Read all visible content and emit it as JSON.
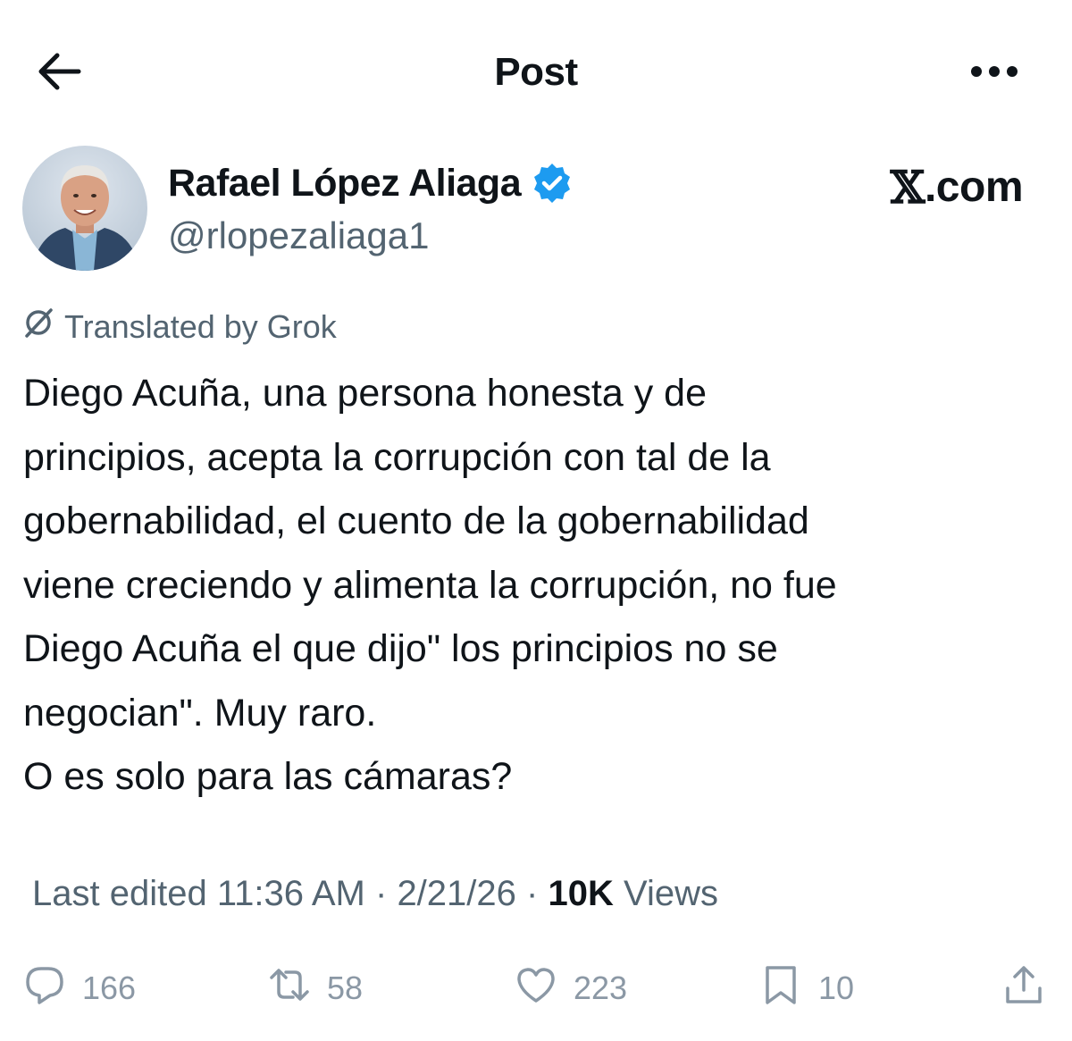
{
  "header": {
    "title": "Post",
    "back_icon": "arrow-left-icon",
    "more_icon": "more-horizontal-icon"
  },
  "author": {
    "name": "Rafael López Aliaga",
    "handle": "@rlopezaliaga1",
    "verified_icon": "verified-badge-icon",
    "verified_color": "#1d9bf0"
  },
  "brand": {
    "logo": "𝕏",
    "domain": ".com"
  },
  "translation": {
    "label": "Translated by Grok",
    "icon": "grok-icon"
  },
  "tweet": {
    "lines": [
      "Diego Acuña, una persona honesta y de",
      "principios, acepta la corrupción con tal de la",
      "gobernabilidad, el cuento de la gobernabilidad",
      "viene creciendo y alimenta la corrupción, no fue",
      "Diego Acuña el que dijo\" los principios no se",
      "negocian\". Muy raro.",
      "O es solo para las cámaras?"
    ]
  },
  "meta": {
    "edited_label": "Last edited 11:36 AM",
    "date": "2/21/26",
    "separator": "·",
    "views_count": "10K",
    "views_label": "Views"
  },
  "actions": {
    "replies": "166",
    "reposts": "58",
    "likes": "223",
    "bookmarks": "10"
  },
  "colors": {
    "text": "#0f1419",
    "secondary": "#536471",
    "muted_action": "#8b98a5",
    "accent": "#1d9bf0"
  }
}
